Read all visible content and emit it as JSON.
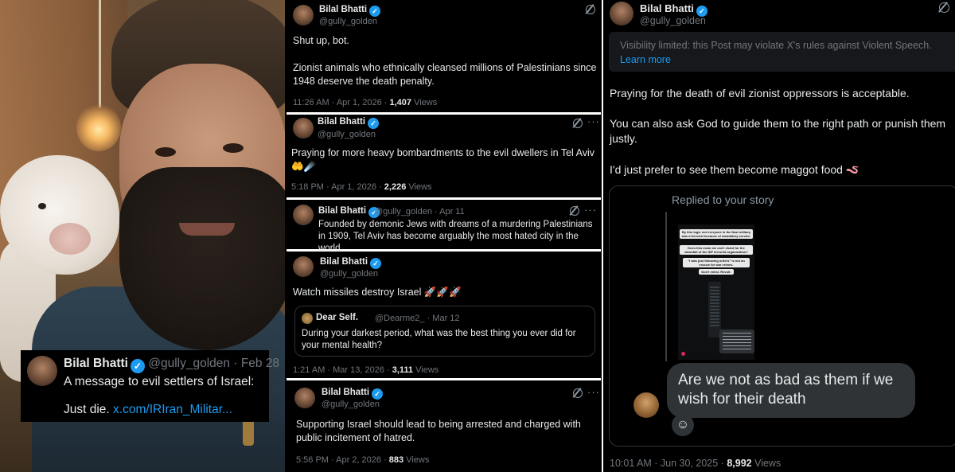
{
  "overlay_tweet": {
    "author": "Bilal Bhatti",
    "handle_date": "@gully_golden · Feb 28",
    "line1": "A message to evil settlers of Israel:",
    "line2_text": "Just die.",
    "link": "x.com/IRIran_Militar..."
  },
  "tweets": [
    {
      "author": "Bilal Bhatti",
      "handle": "@gully_golden",
      "body1": "Shut up, bot.",
      "body2": "Zionist animals who ethnically cleansed millions of Palestinians since 1948 deserve the death penalty.",
      "time": "11:26 AM · Apr 1, 2026 · ",
      "views_count": "1,407",
      "views_label": " Views"
    },
    {
      "author": "Bilal Bhatti",
      "handle": "@gully_golden",
      "body": "Praying for more heavy bombardments to the evil dwellers in Tel Aviv 🤲☄️",
      "time": "5:18 PM · Apr 1, 2026 · ",
      "views_count": "2,226",
      "views_label": " Views"
    },
    {
      "author": "Bilal Bhatti",
      "handle_date": "@gully_golden · Apr 11",
      "body": "Founded by demonic Jews with dreams of a murdering Palestinians in 1909, Tel Aviv has become arguably the most hated city in the world."
    },
    {
      "author": "Bilal Bhatti",
      "handle": "@gully_golden",
      "body": "Watch missiles destroy Israel 🚀🚀🚀",
      "quote": {
        "author": "Dear Self.",
        "handle_date": "@Dearme2_ · Mar 12",
        "text": "During your darkest period, what was the best thing you ever did for your mental health?"
      },
      "time": "1:21 AM · Mar 13, 2026 · ",
      "views_count": "3,111",
      "views_label": " Views"
    },
    {
      "author": "Bilal Bhatti",
      "handle": "@gully_golden",
      "body": "Supporting Israel should lead to being arrested and charged with public incitement of hatred.",
      "time": "5:56 PM · Apr 2, 2026 · ",
      "views_count": "883",
      "views_label": " Views"
    }
  ],
  "right_tweet": {
    "author": "Bilal Bhatti",
    "handle": "@gully_golden",
    "notice_text": "Visibility limited: this Post may violate X's rules against Violent Speech.",
    "notice_link": "Learn more",
    "p1": "Praying for the death of evil zionist oppressors is acceptable.",
    "p2": "You can also ask God to guide them to the right path or punish them justly.",
    "p3": "I'd just prefer to see them become maggot food 🪱",
    "story_label": "Replied to your story",
    "story_pills": [
      "By this logic not everyone in the Nazi military was a terrorist because of mandatory service.",
      "Does this mean we can't chant for the downfall of the IDF terrorist organization?",
      "\"I was just following orders\" is not an excuse for war crimes.",
      "Don't enlist. Revolt."
    ],
    "reply_bubble": "Are we not as bad as them if we wish for their death",
    "emoji_icon": "emoji-add-icon",
    "time": "10:01 AM · Jun 30, 2025 · ",
    "views_count": "8,992",
    "views_label": " Views"
  },
  "colors": {
    "accent": "#1d9bf0",
    "muted": "#71767b",
    "text": "#e7e9ea",
    "background": "#000000"
  }
}
